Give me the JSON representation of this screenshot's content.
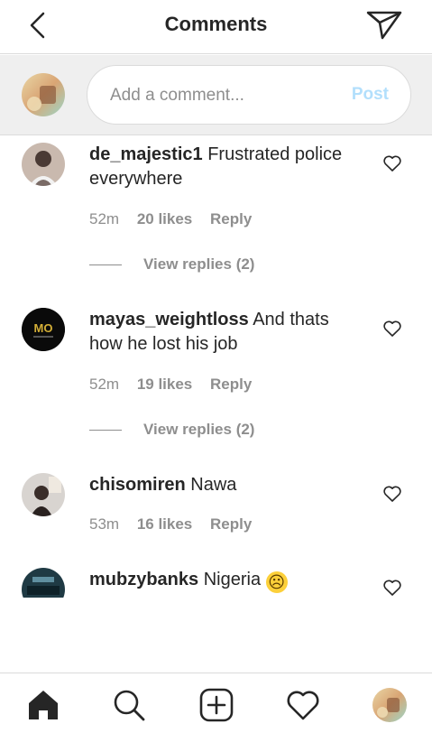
{
  "header": {
    "title": "Comments",
    "back_icon": "chevron-left-icon",
    "send_icon": "paper-plane-icon"
  },
  "composer": {
    "placeholder": "Add a comment...",
    "post_label": "Post"
  },
  "comments": [
    {
      "username": "de_majestic1",
      "text": "Frustrated police everywhere",
      "time": "52m",
      "likes": "20 likes",
      "reply": "Reply",
      "view_replies": "View replies (2)"
    },
    {
      "username": "mayas_weightloss",
      "text": "And thats how he lost his job",
      "time": "52m",
      "likes": "19 likes",
      "reply": "Reply",
      "view_replies": "View replies (2)",
      "avatar_text": "MO"
    },
    {
      "username": "chisomiren",
      "text": "Nawa",
      "time": "53m",
      "likes": "16 likes",
      "reply": "Reply"
    },
    {
      "username": "mubzybanks",
      "text": "Nigeria",
      "emoji": "☹"
    }
  ],
  "tabbar": {
    "items": [
      "home-icon",
      "search-icon",
      "add-post-icon",
      "activity-heart-icon",
      "profile-avatar"
    ]
  },
  "colors": {
    "text": "#262626",
    "muted": "#8e8e8e",
    "post_disabled": "#b2dffc",
    "composer_bg": "#efefef",
    "border": "#dbdbdb"
  }
}
